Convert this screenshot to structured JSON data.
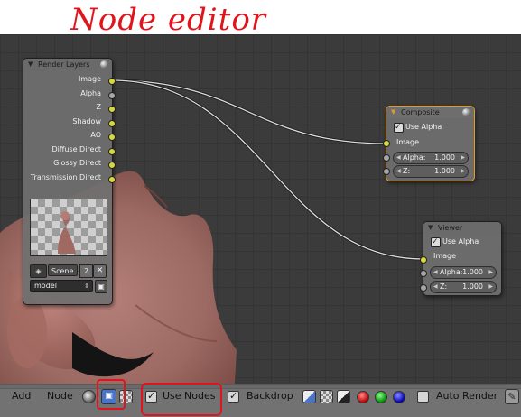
{
  "annotation": {
    "title": "Node editor"
  },
  "render_layers_node": {
    "title": "Render Layers",
    "outputs": [
      "Image",
      "Alpha",
      "Z",
      "Shadow",
      "AO",
      "Diffuse Direct",
      "Glossy Direct",
      "Transmission Direct"
    ],
    "scene_label": "Scene",
    "scene_users": "2",
    "layer_value": "model"
  },
  "composite_node": {
    "title": "Composite",
    "use_alpha_label": "Use Alpha",
    "image_input_label": "Image",
    "alpha_label": "Alpha:",
    "alpha_value": "1.000",
    "z_label": "Z:",
    "z_value": "1.000"
  },
  "viewer_node": {
    "title": "Viewer",
    "use_alpha_label": "Use Alpha",
    "image_input_label": "Image",
    "alpha_label": "Alpha:",
    "alpha_value": "1.000",
    "z_label": "Z:",
    "z_value": "1.000"
  },
  "toolbar": {
    "add_label": "Add",
    "node_label": "Node",
    "use_nodes_label": "Use Nodes",
    "backdrop_label": "Backdrop",
    "auto_render_label": "Auto Render"
  },
  "colors": {
    "annotation": "#e0141c",
    "socket_color": "#d8d83c",
    "socket_value": "#a6a6a6",
    "active_node_border": "#e39a2c",
    "skin": "#9c6a63"
  }
}
